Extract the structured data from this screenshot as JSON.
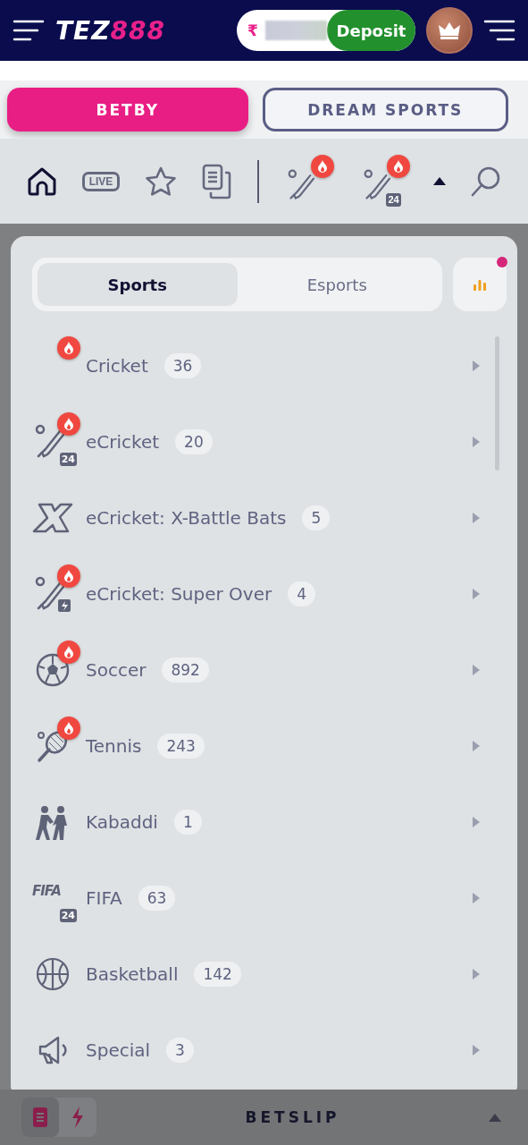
{
  "header": {
    "logo_part1": "TEZ",
    "logo_part2": "888",
    "currency": "₹",
    "deposit": "Deposit"
  },
  "providers": [
    {
      "label": "BETBY",
      "selected": true
    },
    {
      "label": "DREAM SPORTS",
      "selected": false
    }
  ],
  "nav": [
    {
      "kind": "home",
      "selected": true
    },
    {
      "kind": "live",
      "label": "LIVE",
      "selected": false
    },
    {
      "kind": "star",
      "selected": false
    },
    {
      "kind": "docs",
      "selected": false
    },
    {
      "kind": "divider"
    },
    {
      "kind": "cricket",
      "hot": true,
      "selected": false
    },
    {
      "kind": "ecricket",
      "badge": "24",
      "hot": true,
      "selected": false
    },
    {
      "kind": "caret"
    },
    {
      "kind": "search",
      "selected": false
    }
  ],
  "tabs": [
    {
      "label": "Sports",
      "selected": true
    },
    {
      "label": "Esports",
      "selected": false
    }
  ],
  "stats_button": {
    "notification": true
  },
  "sports": [
    {
      "name": "Cricket",
      "count": "36",
      "kind": "none",
      "hot": true
    },
    {
      "name": "eCricket",
      "count": "20",
      "kind": "ecricket",
      "badge": "24",
      "hot": true
    },
    {
      "name": "eCricket: X-Battle Bats",
      "count": "5",
      "kind": "xbat",
      "hot": false
    },
    {
      "name": "eCricket: Super Over",
      "count": "4",
      "kind": "superover",
      "hot": true
    },
    {
      "name": "Soccer",
      "count": "892",
      "kind": "soccer",
      "hot": true
    },
    {
      "name": "Tennis",
      "count": "243",
      "kind": "tennis",
      "hot": true
    },
    {
      "name": "Kabaddi",
      "count": "1",
      "kind": "kabaddi",
      "hot": false
    },
    {
      "name": "FIFA",
      "count": "63",
      "kind": "fifa",
      "icon_text": "FIFA",
      "badge": "24",
      "hot": false
    },
    {
      "name": "Basketball",
      "count": "142",
      "kind": "basketball",
      "hot": false
    },
    {
      "name": "Special",
      "count": "3",
      "kind": "special",
      "hot": false
    }
  ],
  "betslip": {
    "title": "BETSLIP",
    "modes": [
      {
        "kind": "slip",
        "selected": true
      },
      {
        "kind": "quick",
        "selected": false
      }
    ]
  }
}
